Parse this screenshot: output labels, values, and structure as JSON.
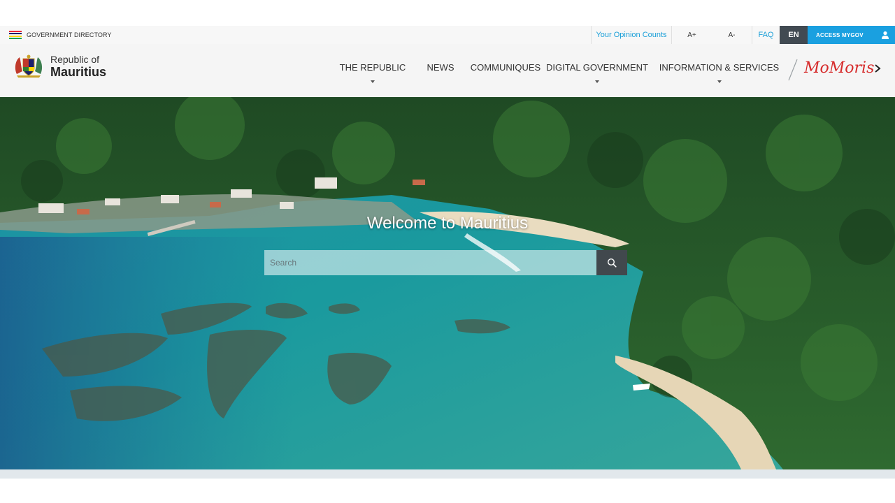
{
  "utility_bar": {
    "gov_directory_label": "GOVERNMENT DIRECTORY",
    "opinion_label": "Your Opinion Counts",
    "font_increase": "A+",
    "font_decrease": "A-",
    "faq_label": "FAQ",
    "language": "EN",
    "access_mygov_label": "ACCESS MYGOV"
  },
  "brand": {
    "line1": "Republic of",
    "line2": "Mauritius"
  },
  "nav": {
    "items": [
      {
        "label": "THE REPUBLIC",
        "has_dropdown": true
      },
      {
        "label": "NEWS",
        "has_dropdown": false
      },
      {
        "label": "COMMUNIQUES",
        "has_dropdown": false
      },
      {
        "label": "DIGITAL GOVERNMENT",
        "has_dropdown": true
      },
      {
        "label": "INFORMATION & SERVICES",
        "has_dropdown": true
      }
    ],
    "momoris_label": "MoMoris"
  },
  "hero": {
    "title": "Welcome to Mauritius",
    "search_placeholder": "Search"
  },
  "colors": {
    "accent_blue": "#1aa0e0",
    "dark_gray": "#414a52",
    "momoris_red": "#d62b2b",
    "header_bg": "#f5f5f5"
  }
}
